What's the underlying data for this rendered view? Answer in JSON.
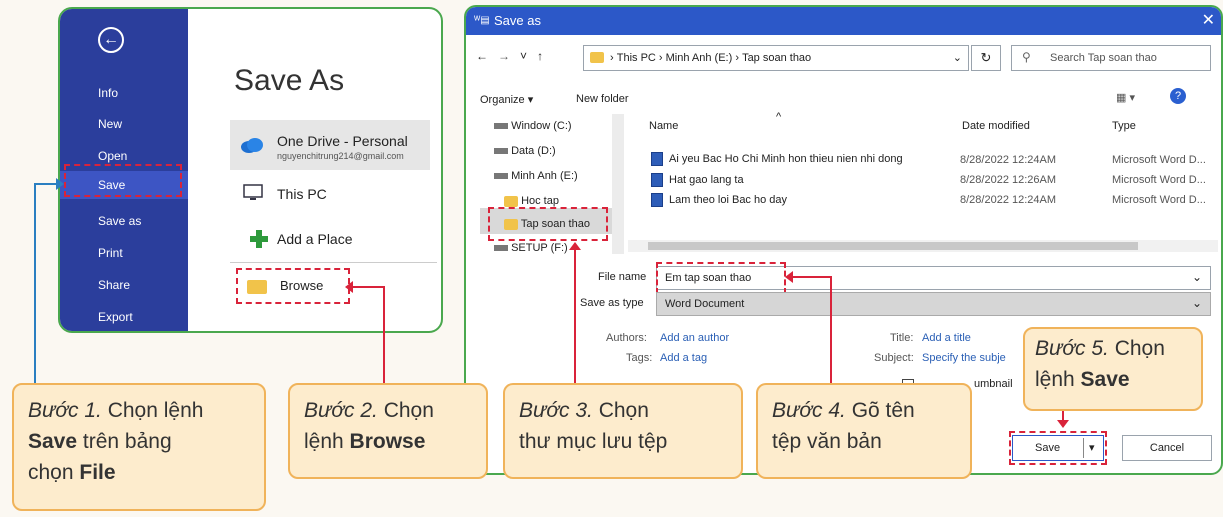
{
  "left_panel": {
    "back_icon": "back-arrow-icon",
    "nav": [
      "Info",
      "New",
      "Open",
      "Save",
      "Save as",
      "Print",
      "Share",
      "Export"
    ],
    "title": "Save As",
    "onedrive_name": "One Drive - Personal",
    "onedrive_email": "nguyenchitrung214@gmail.com",
    "this_pc": "This PC",
    "add_place": "Add a Place",
    "browse": "Browse"
  },
  "dialog": {
    "title": "Save as",
    "breadcrumb": [
      "This PC",
      "Minh Anh (E:)",
      "Tap soan thao"
    ],
    "search_placeholder": "Search Tap soan thao",
    "organize": "Organize ▾",
    "new_folder": "New folder",
    "tree": [
      "Window (C:)",
      "Data (D:)",
      "Minh Anh (E:)",
      "Hoc tap",
      "Tap soan thao",
      "SETUP (F:)"
    ],
    "columns": {
      "name": "Name",
      "date": "Date modified",
      "type": "Type"
    },
    "files": [
      {
        "name": "Ai yeu Bac Ho Chi Minh hon thieu nien nhi dong",
        "date": "8/28/2022 12:24AM",
        "type": "Microsoft Word D..."
      },
      {
        "name": "Hat gao lang ta",
        "date": "8/28/2022 12:26AM",
        "type": "Microsoft Word D..."
      },
      {
        "name": "Lam theo loi Bac ho day",
        "date": "8/28/2022 12:24AM",
        "type": "Microsoft Word D..."
      }
    ],
    "file_name_label": "File name",
    "file_name_value": "Em tap soan thao",
    "save_type_label": "Save as type",
    "save_type_value": "Word Document",
    "authors_label": "Authors:",
    "authors_value": "Add an author",
    "tags_label": "Tags:",
    "tags_value": "Add a tag",
    "title_label": "Title:",
    "title_value": "Add a title",
    "subject_label": "Subject:",
    "subject_value": "Specify the subje",
    "thumbnail_partial": "umbnail",
    "save_button": "Save",
    "cancel_button": "Cancel"
  },
  "callouts": {
    "step1": {
      "italic": "Bước 1.",
      "line1_rest": " Chọn lệnh",
      "bold": "Save",
      "line2_rest": " trên bảng",
      "line3": "chọn ",
      "bold2": "File"
    },
    "step2": {
      "italic": "Bước 2.",
      "rest": " Chọn",
      "line2": "lệnh ",
      "bold": "Browse"
    },
    "step3": {
      "italic": "Bước 3.",
      "rest": " Chọn",
      "line2": "thư mục lưu tệp"
    },
    "step4": {
      "italic": "Bước 4.",
      "rest": " Gõ tên",
      "line2": "tệp văn bản"
    },
    "step5": {
      "italic": "Bước 5.",
      "rest": " Chọn",
      "line2": "lệnh ",
      "bold": "Save"
    }
  },
  "colors": {
    "nav_blue": "#2b3e9c",
    "title_blue": "#2c58c8",
    "callout_fill": "#fdeccd",
    "callout_border": "#f0b35a",
    "dash_red": "#d9233a",
    "green_border": "#4aa84e"
  }
}
